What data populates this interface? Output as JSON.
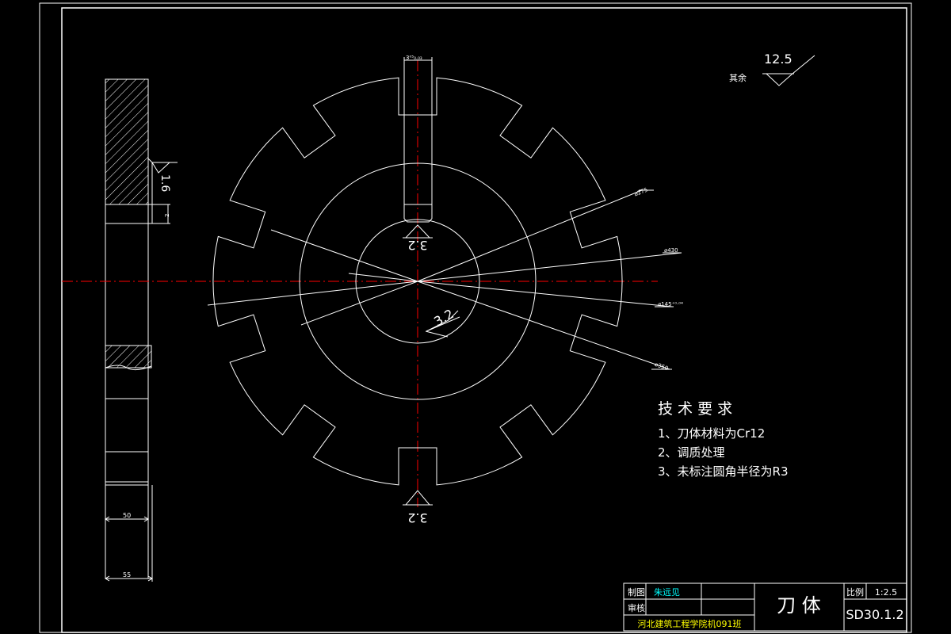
{
  "colors": {
    "background": "#000000",
    "line": "#ffffff",
    "centerline": "#ff0000",
    "title_text": "#00ffff",
    "school_text": "#ffff00",
    "green_text": "#00ff00"
  },
  "dimensions": {
    "slot_width": "3⁰⁵₀.₀₃",
    "d_275": "⌀275",
    "d_430": "⌀430",
    "d_145": "⌀145⁺⁰·⁰⁴",
    "d_350": "⌀350",
    "side_width_50": "50",
    "side_width_55": "55",
    "side_step": "2",
    "side_step_b": "0.5"
  },
  "surface_finish": {
    "top_right_label": "其余",
    "top_right_value": "12.5",
    "keyway_top": "3.2",
    "center_bore": "3.2",
    "bottom": "3.2",
    "side": "1.6"
  },
  "technical_requirements": {
    "title": "技 术 要 求",
    "items": [
      "1、刀体材料为Cr12",
      "2、调质处理",
      "3、未标注圆角半径为R3"
    ]
  },
  "title_block": {
    "drawn_label": "制图",
    "drawn_name": "朱远见",
    "checked_label": "审核",
    "part_name": "刀 体",
    "scale_label": "比例",
    "scale_value": "1:2.5",
    "drawing_no": "SD30.1.2",
    "school": "河北建筑工程学院机091班"
  }
}
